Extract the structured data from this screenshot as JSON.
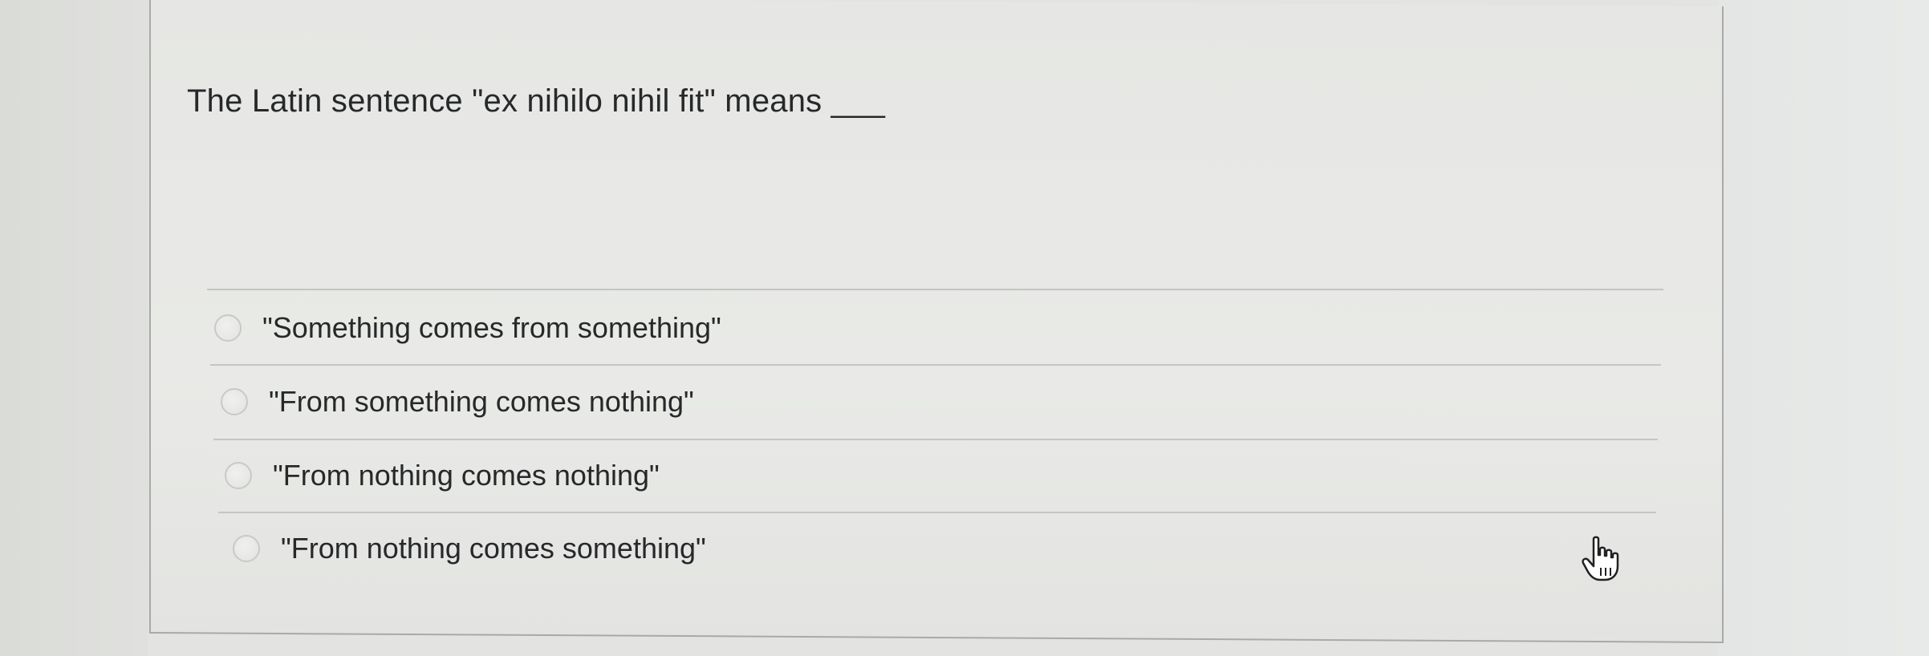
{
  "question": {
    "text": "The Latin sentence \"ex nihilo nihil fit\" means ___"
  },
  "options": [
    {
      "label": "\"Something comes from something\"",
      "selected": false
    },
    {
      "label": "\"From something comes nothing\"",
      "selected": false
    },
    {
      "label": "\"From nothing comes nothing\"",
      "selected": false
    },
    {
      "label": "\"From nothing comes something\"",
      "selected": false
    }
  ],
  "cursor": {
    "icon": "hand-pointer-icon"
  }
}
